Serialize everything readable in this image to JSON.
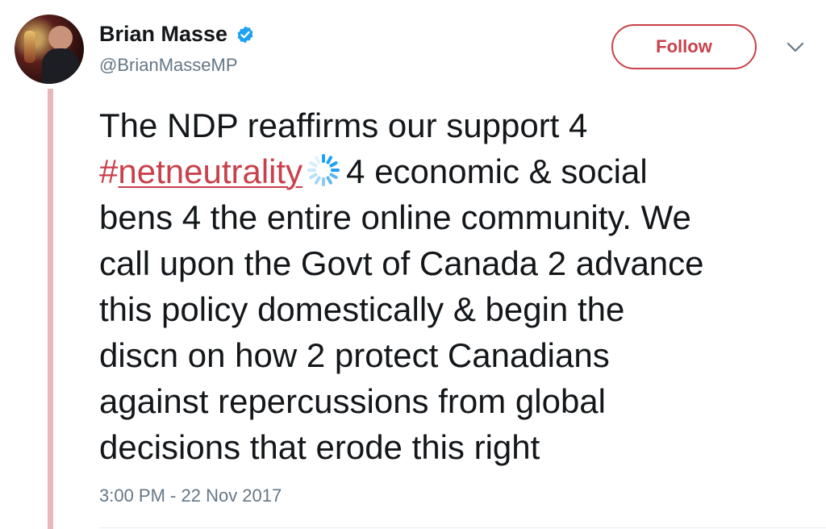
{
  "user": {
    "display_name": "Brian Masse",
    "handle": "@BrianMasseMP",
    "verified": true
  },
  "actions": {
    "follow_label": "Follow"
  },
  "tweet": {
    "line1": "The NDP reaffirms our support 4",
    "hashtag_symbol": "#",
    "hashtag_word": "netneutrality",
    "line2_rest": "4 economic & social",
    "line3": "bens 4 the entire online community. We",
    "line4": "call upon the Govt of Canada 2 advance",
    "line5": "this policy domestically & begin the",
    "line6": "discn on how 2 protect Canadians",
    "line7": "against repercussions from global",
    "line8": "decisions that erode this right",
    "timestamp": "3:00 PM - 22 Nov 2017"
  },
  "colors": {
    "accent": "#c8414b",
    "verified_blue": "#1da1f2",
    "thread_line": "#e8b9bc",
    "muted": "#657786"
  },
  "icons": {
    "verified": "verified-badge-icon",
    "more": "chevron-down-icon",
    "hashtag_emoji": "spinner-emoji-icon"
  }
}
